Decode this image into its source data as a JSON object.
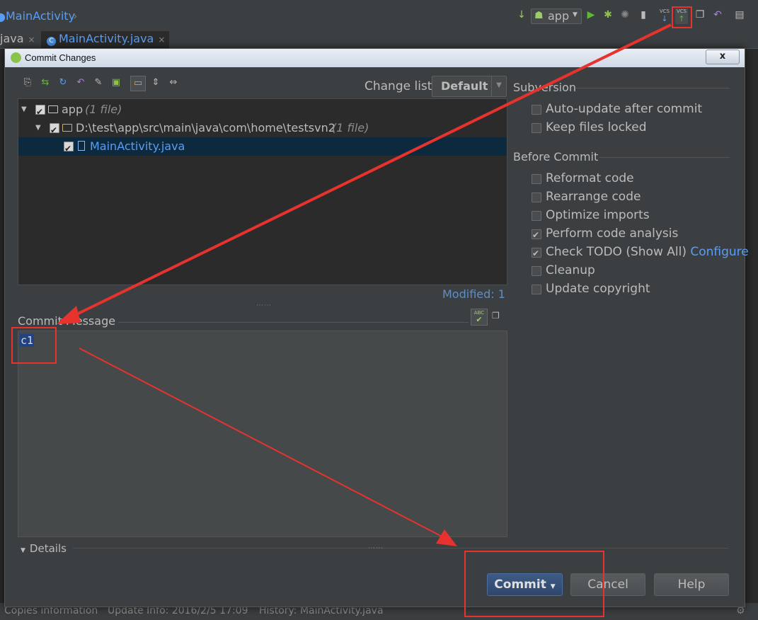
{
  "ide": {
    "breadcrumb": "MainActivity",
    "run_config": "app",
    "tabs": [
      {
        "label": "java"
      },
      {
        "label": "MainActivity.java"
      }
    ],
    "vcs_update_label": "VCS",
    "vcs_commit_label": "VCS",
    "status": {
      "copies": "Copies information",
      "update_info": "Update Info: 2016/2/5 17:09",
      "history": "History: MainActivity.java"
    }
  },
  "dialog": {
    "title": "Commit Changes",
    "close_label": "x",
    "change_list_label": "Change list:",
    "change_list_value": "Default",
    "tree": [
      {
        "label": "app",
        "note": "(1 file)"
      },
      {
        "label": "D:\\test\\app\\src\\main\\java\\com\\home\\testsvn2",
        "note": "(1 file)"
      },
      {
        "label": "MainActivity.java",
        "note": ""
      }
    ],
    "modified": "Modified: 1",
    "commit_message_label": "Commit Message",
    "commit_message": "c1",
    "spell_icon_text": "ABC",
    "details_label": "Details",
    "subversion": {
      "title": "Subversion",
      "options": [
        {
          "label": "Auto-update after commit",
          "checked": false
        },
        {
          "label": "Keep files locked",
          "checked": false
        }
      ]
    },
    "before_commit": {
      "title": "Before Commit",
      "options": [
        {
          "label": "Reformat code",
          "checked": false
        },
        {
          "label": "Rearrange code",
          "checked": false
        },
        {
          "label": "Optimize imports",
          "checked": false
        },
        {
          "label": "Perform code analysis",
          "checked": true
        },
        {
          "label": "Check TODO (Show All)",
          "checked": true,
          "link": "Configure"
        },
        {
          "label": "Cleanup",
          "checked": false
        },
        {
          "label": "Update copyright",
          "checked": false
        }
      ]
    },
    "buttons": {
      "commit": "Commit",
      "cancel": "Cancel",
      "help": "Help"
    }
  },
  "annotation_color": "#e8322d"
}
